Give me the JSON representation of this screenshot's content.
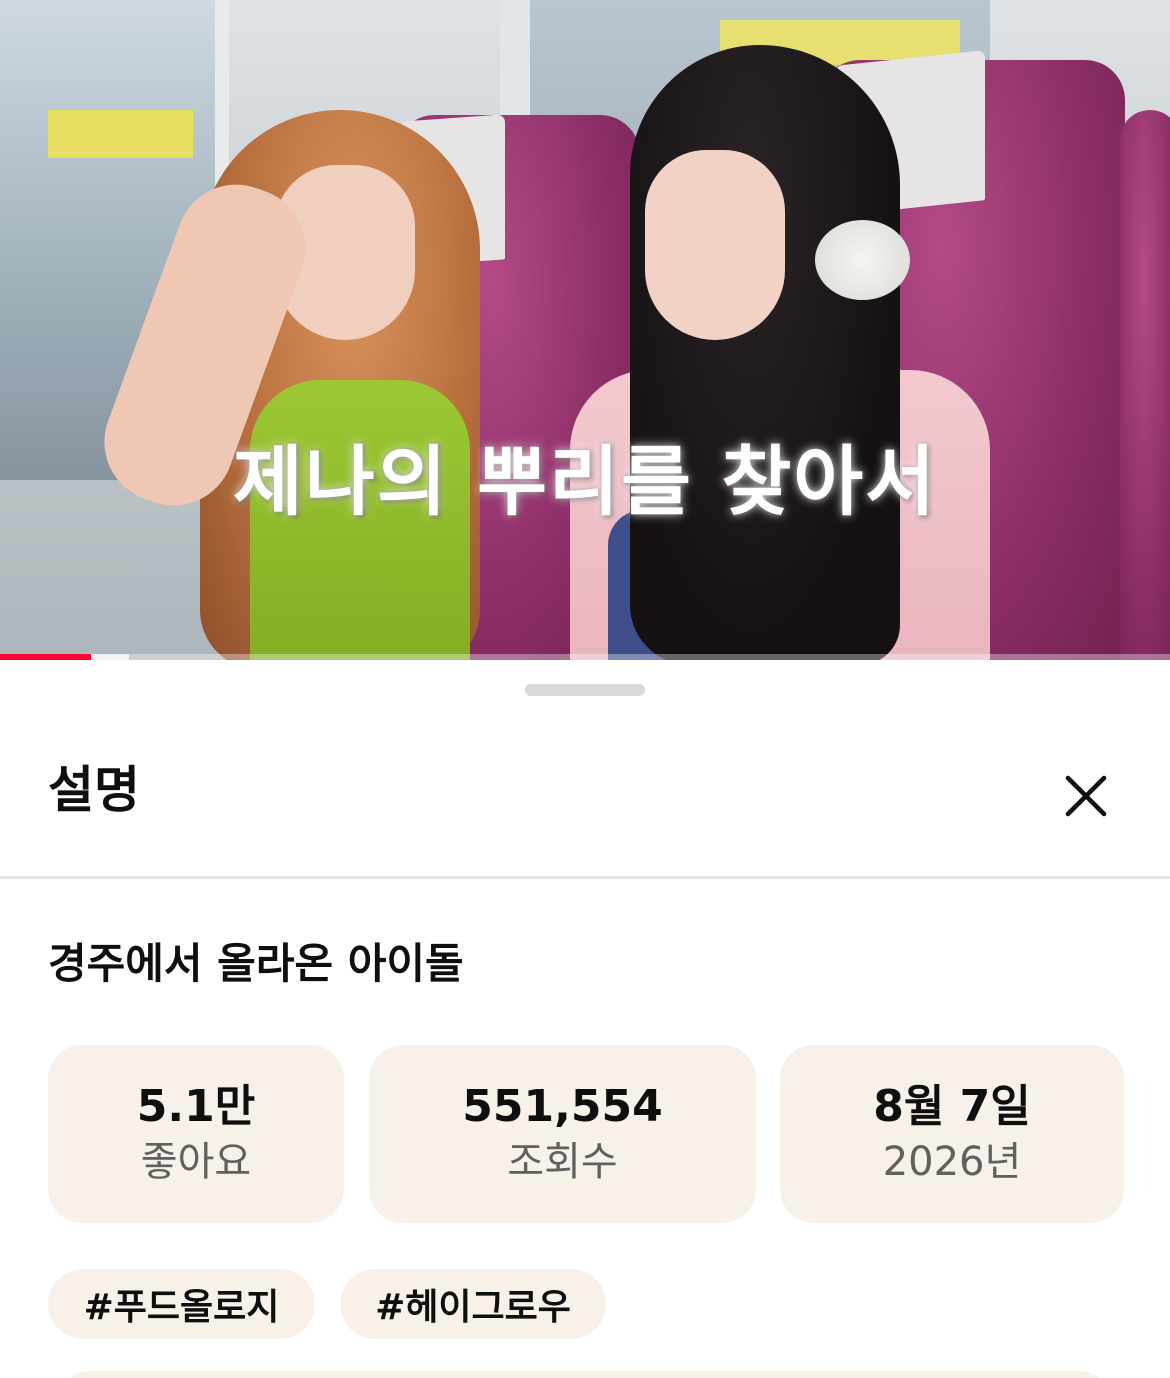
{
  "video": {
    "caption": "제나의 뿌리를 찾아서",
    "progress_percent": 7.8,
    "buffered_percent": 11
  },
  "sheet": {
    "title": "설명",
    "close_icon": "close-icon"
  },
  "description": {
    "video_title": "경주에서 올라온 아이돌",
    "stats": [
      {
        "value": "5.1만",
        "label": "좋아요"
      },
      {
        "value": "551,554",
        "label": "조회수"
      },
      {
        "value": "8월 7일",
        "label": "2026년"
      }
    ],
    "hashtags": [
      "#푸드올로지",
      "#헤이그로우"
    ]
  },
  "colors": {
    "progress": "#ff0033",
    "card_background": "#f7f1e9",
    "text_primary": "#0f0f0f",
    "text_secondary": "#606060"
  }
}
